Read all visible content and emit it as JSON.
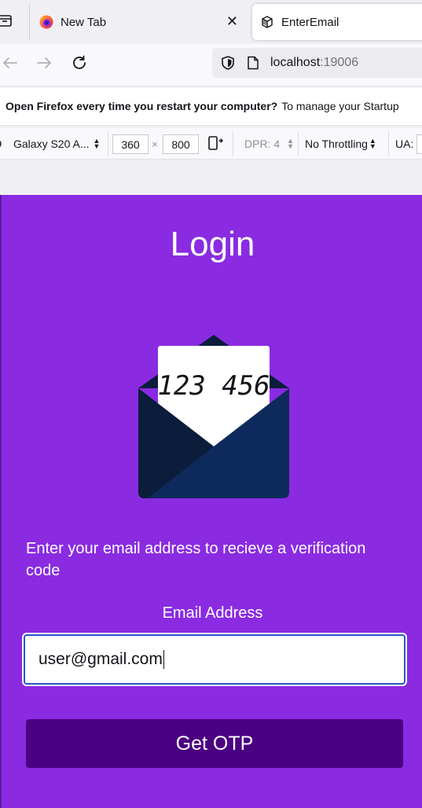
{
  "browser": {
    "tabs": [
      {
        "label": "New Tab",
        "close_glyph": "✕"
      },
      {
        "label": "EnterEmail"
      }
    ],
    "url": {
      "host": "localhost",
      "port": ":19006"
    },
    "notification": {
      "bold": "Open Firefox every time you restart your computer?",
      "text": "To manage your Startup"
    },
    "rdm": {
      "device": "Galaxy S20 A...",
      "width": "360",
      "times": "×",
      "height": "800",
      "dpr": "DPR: 4",
      "throttling": "No Throttling",
      "ua": "UA:"
    }
  },
  "page": {
    "title": "Login",
    "otp_digits": "123 456",
    "instruction": "Enter your email address to recieve a verification code",
    "email_label": "Email Address",
    "email_value": "user@gmail.com",
    "button_label": "Get OTP"
  },
  "colors": {
    "background": "#8a2be2",
    "button": "#4b0082",
    "envelope_dark": "#0b1d3a",
    "envelope_body": "#0e2a5c"
  },
  "icons": [
    "tab-list-icon",
    "firefox-icon",
    "close-icon",
    "page-favicon-icon",
    "back-icon",
    "forward-icon",
    "reload-icon",
    "shield-icon",
    "page-icon",
    "rotate-icon",
    "envelope-icon"
  ]
}
